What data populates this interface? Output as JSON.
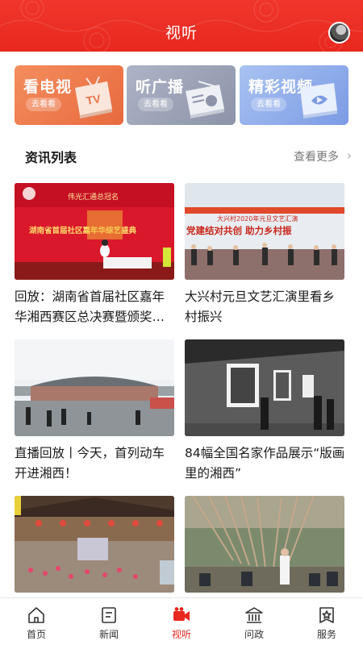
{
  "header": {
    "title": "视听"
  },
  "categories": [
    {
      "label": "看电视",
      "more": "去看看",
      "icon": "tv-icon"
    },
    {
      "label": "听广播",
      "more": "去看看",
      "icon": "radio-icon"
    },
    {
      "label": "精彩视频",
      "more": "去看看",
      "icon": "video-play-icon"
    }
  ],
  "section": {
    "title": "资讯列表",
    "more": "查看更多"
  },
  "news": [
    {
      "title": "回放：湖南省首届社区嘉年华湘西赛区总决赛暨颁奖…"
    },
    {
      "title": "大兴村元旦文艺汇演里看乡村振兴"
    },
    {
      "title": "直播回放丨今天，首列动车开进湘西！"
    },
    {
      "title": "84幅全国名家作品展示“版画里的湘西”"
    },
    {
      "title": ""
    },
    {
      "title": ""
    }
  ],
  "thumb_text": {
    "n1_banner": "伟光汇通总冠名",
    "n1_main": "湖南省首届社区嘉年华综艺盛典",
    "n2_banner": "大兴村2020年元旦文艺汇演",
    "n2_main": "党建结对共创 助力乡村振"
  },
  "tabbar": {
    "items": [
      {
        "label": "首页",
        "icon": "home-icon"
      },
      {
        "label": "新闻",
        "icon": "news-icon"
      },
      {
        "label": "视听",
        "icon": "video-camera-icon",
        "active": true
      },
      {
        "label": "问政",
        "icon": "government-icon"
      },
      {
        "label": "服务",
        "icon": "service-star-icon"
      }
    ]
  },
  "colors": {
    "brand": "#e8281f",
    "tv_card": "#ee7a4b",
    "radio_card": "#9ea4b8",
    "video_card": "#8fabeb"
  }
}
